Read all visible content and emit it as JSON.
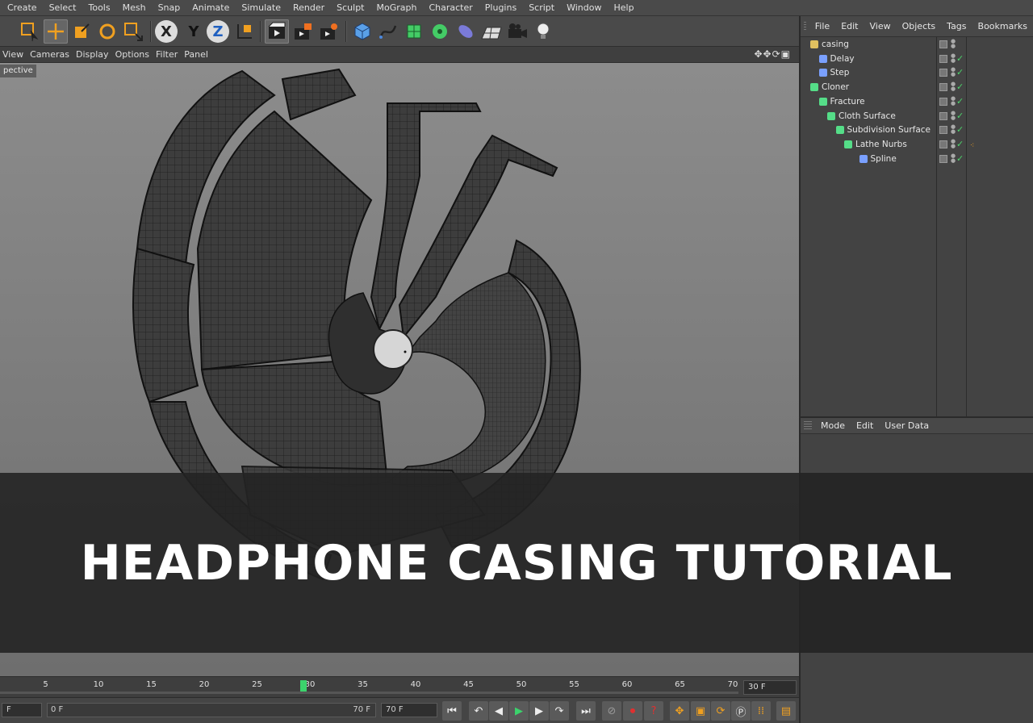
{
  "menubar": {
    "items": [
      "Create",
      "Select",
      "Tools",
      "Mesh",
      "Snap",
      "Animate",
      "Simulate",
      "Render",
      "Sculpt",
      "MoGraph",
      "Character",
      "Plugins",
      "Script",
      "Window",
      "Help"
    ]
  },
  "toolbar": {
    "axis_x": "X",
    "axis_y": "Y",
    "axis_z": "Z"
  },
  "viewport": {
    "menu": [
      "View",
      "Cameras",
      "Display",
      "Options",
      "Filter",
      "Panel"
    ],
    "label": "pective"
  },
  "timeline": {
    "ticks": [
      "5",
      "10",
      "15",
      "20",
      "25",
      "30",
      "35",
      "40",
      "45",
      "50",
      "55",
      "60",
      "65",
      "70"
    ],
    "current_frame": 30,
    "end_field": "30 F"
  },
  "transport": {
    "start_field": "F",
    "range_start": "0 F",
    "range_end": "70 F",
    "end_field": "70 F"
  },
  "object_manager": {
    "menu": [
      "File",
      "Edit",
      "View",
      "Objects",
      "Tags",
      "Bookmarks"
    ],
    "objects": [
      {
        "name": "casing",
        "depth": 0,
        "icon": "null-object-icon",
        "color": "#e0c060"
      },
      {
        "name": "Delay",
        "depth": 1,
        "icon": "delay-effector-icon",
        "color": "#7aa0ff"
      },
      {
        "name": "Step",
        "depth": 1,
        "icon": "step-effector-icon",
        "color": "#7aa0ff"
      },
      {
        "name": "Cloner",
        "depth": 0,
        "icon": "cloner-icon",
        "color": "#55dd88"
      },
      {
        "name": "Fracture",
        "depth": 1,
        "icon": "fracture-icon",
        "color": "#55dd88"
      },
      {
        "name": "Cloth Surface",
        "depth": 2,
        "icon": "cloth-surface-icon",
        "color": "#55dd88"
      },
      {
        "name": "Subdivision Surface",
        "depth": 3,
        "icon": "subdivision-surface-icon",
        "color": "#55dd88"
      },
      {
        "name": "Lathe Nurbs",
        "depth": 4,
        "icon": "lathe-nurbs-icon",
        "color": "#55dd88"
      },
      {
        "name": "Spline",
        "depth": 5,
        "icon": "spline-icon",
        "color": "#7aa0ff"
      }
    ]
  },
  "attribute_manager": {
    "menu": [
      "Mode",
      "Edit",
      "User Data"
    ]
  },
  "banner": {
    "title": "HEADPHONE CASING TUTORIAL"
  },
  "colors": {
    "accent_orange": "#f0a020",
    "timeline_green": "#3bd36c",
    "check_green": "#4dd36b"
  }
}
